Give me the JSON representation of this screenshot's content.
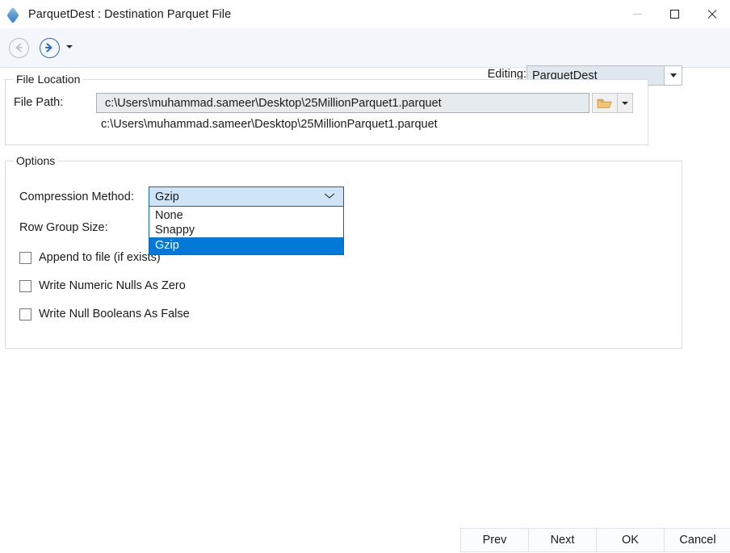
{
  "window": {
    "title": "ParquetDest : Destination Parquet File",
    "icon": "gem-icon",
    "minimize_label": "Minimize",
    "maximize_label": "Maximize",
    "close_label": "Close"
  },
  "toolbar": {
    "back_label": "Back",
    "forward_label": "Forward",
    "history_caret_label": "History",
    "editing_label": "Editing:",
    "editing_value": "ParquetDest",
    "editing_options": [
      "ParquetDest"
    ]
  },
  "file_location": {
    "legend": "File Location",
    "path_label": "File Path:",
    "path_value": "c:\\Users\\muhammad.sameer\\Desktop\\25MillionParquet1.parquet",
    "path_placeholder": "",
    "path_echo": "c:\\Users\\muhammad.sameer\\Desktop\\25MillionParquet1.parquet",
    "browse_label": "Browse",
    "browse_icon": "folder-icon",
    "browse_caret_label": "More options"
  },
  "options": {
    "legend": "Options",
    "compression_label": "Compression Method:",
    "compression_value": "Gzip",
    "compression_items": [
      {
        "label": "None",
        "selected": false
      },
      {
        "label": "Snappy",
        "selected": false
      },
      {
        "label": "Gzip",
        "selected": true
      }
    ],
    "row_group_label": "Row Group Size:",
    "checkboxes": [
      {
        "label": "Append to file (if exists)",
        "checked": false
      },
      {
        "label": "Write Numeric Nulls As Zero",
        "checked": false
      },
      {
        "label": "Write Null Booleans As False",
        "checked": false
      }
    ]
  },
  "buttons": {
    "prev": "Prev",
    "next": "Next",
    "ok": "OK",
    "cancel": "Cancel"
  },
  "colors": {
    "accent": "#0078d7",
    "combo_border": "#1464a0",
    "combo_fill": "#cfe4f7",
    "toolbar_bg": "#f3f6fa",
    "group_border": "#d7dde3",
    "forward_arrow": "#2f6cae",
    "back_arrow": "#b9bcc0",
    "folder_icon": "#e8b760"
  }
}
